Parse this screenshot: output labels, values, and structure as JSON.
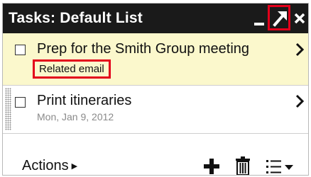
{
  "window": {
    "title": "Tasks: Default List",
    "minimize_icon": "minimize-icon",
    "popout_icon": "popout-arrow-icon",
    "close_icon": "close-icon"
  },
  "tasks": [
    {
      "title": "Prep for the Smith Group meeting",
      "link_label": "Related email",
      "completed": false,
      "highlighted": true
    },
    {
      "title": "Print itineraries",
      "due_date": "Mon, Jan 9, 2012",
      "completed": false,
      "highlighted": false
    }
  ],
  "footer": {
    "actions_label": "Actions",
    "add_icon": "plus-icon",
    "delete_icon": "trash-icon",
    "lists_icon": "list-menu-icon"
  },
  "colors": {
    "titlebar": "#1a1a1a",
    "highlight_row": "#fbf8cc",
    "callout_border": "#e3001b",
    "secondary_text": "#8a8a8a"
  }
}
